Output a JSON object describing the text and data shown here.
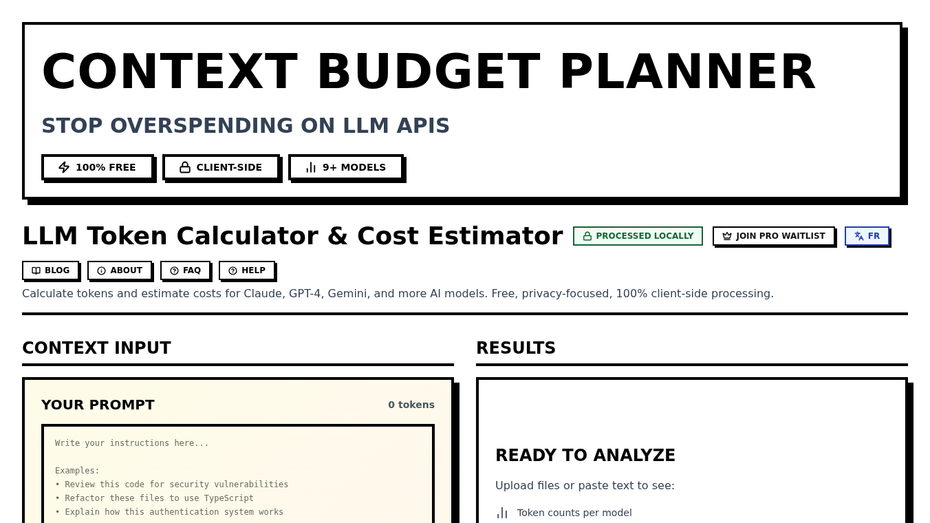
{
  "hero": {
    "title": "CONTEXT BUDGET PLANNER",
    "subtitle": "STOP OVERSPENDING ON LLM APIS",
    "badges": [
      {
        "kind": "free",
        "label": "100% FREE"
      },
      {
        "kind": "lock",
        "label": "CLIENT-SIDE"
      },
      {
        "kind": "chart",
        "label": "9+ MODELS"
      }
    ]
  },
  "header": {
    "title": "LLM Token Calculator & Cost Estimator",
    "actions": [
      {
        "kind": "local",
        "label": "PROCESSED LOCALLY"
      },
      {
        "kind": "pro",
        "label": "JOIN PRO WAITLIST"
      },
      {
        "kind": "lang",
        "label": "FR"
      }
    ],
    "nav": [
      {
        "kind": "blog",
        "label": "BLOG"
      },
      {
        "kind": "about",
        "label": "ABOUT"
      },
      {
        "kind": "faq",
        "label": "FAQ"
      },
      {
        "kind": "help",
        "label": "HELP"
      }
    ],
    "description": "Calculate tokens and estimate costs for Claude, GPT-4, Gemini, and more AI models. Free, privacy-focused, 100% client-side processing."
  },
  "input": {
    "heading": "CONTEXT INPUT",
    "prompt": {
      "title": "YOUR PROMPT",
      "count": "0 tokens",
      "placeholder": "Write your instructions here...\n\nExamples:\n• Review this code for security vulnerabilities\n• Refactor these files to use TypeScript\n• Explain how this authentication system works"
    }
  },
  "results": {
    "heading": "RESULTS",
    "title": "READY TO ANALYZE",
    "intro": "Upload files or paste text to see:",
    "items": [
      {
        "kind": "chart",
        "label": "Token counts per model"
      }
    ]
  }
}
